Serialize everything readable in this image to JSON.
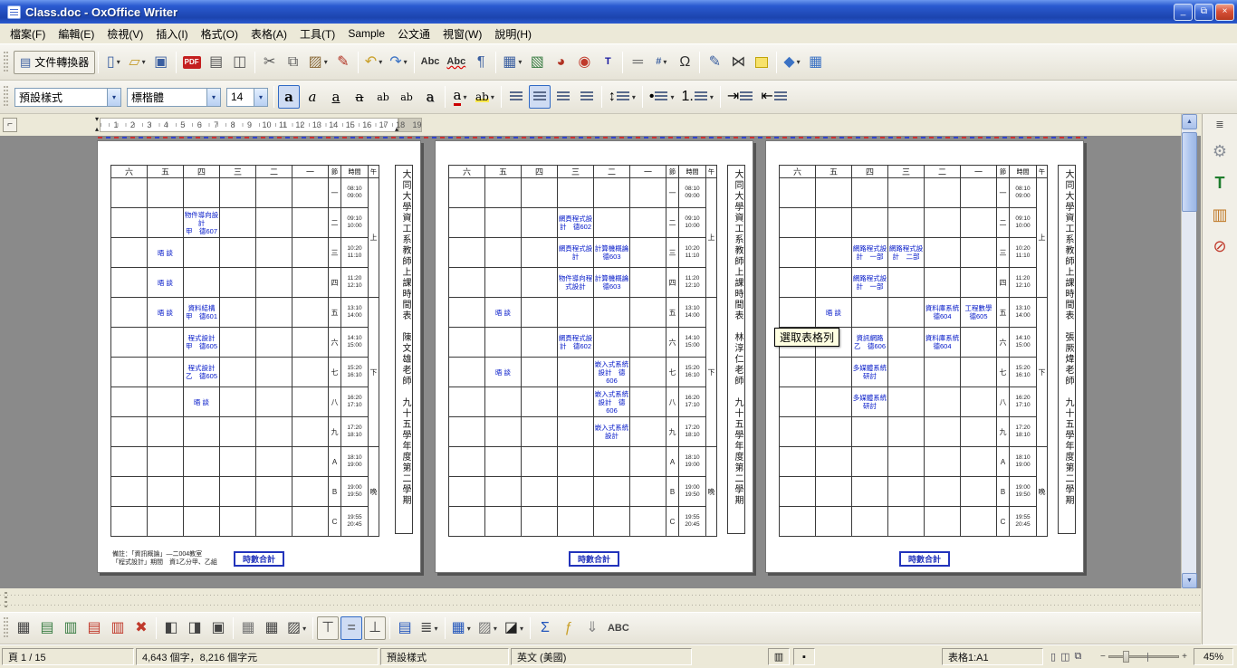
{
  "window": {
    "title": "Class.doc - OxOffice Writer",
    "controls": {
      "minimize": "_",
      "restore": "⧉",
      "close": "×"
    }
  },
  "menu": [
    "檔案(F)",
    "編輯(E)",
    "檢視(V)",
    "插入(I)",
    "格式(O)",
    "表格(A)",
    "工具(T)",
    "Sample",
    "公文通",
    "視窗(W)",
    "說明(H)"
  ],
  "toolbar_main": {
    "converter": "文件轉換器",
    "buttons": [
      {
        "n": "new-document-button",
        "g": "▯",
        "c": "#3b5fa0",
        "dd": true
      },
      {
        "n": "open-button",
        "g": "▱",
        "c": "#c49a2a",
        "dd": true
      },
      {
        "n": "save-button",
        "g": "▣",
        "c": "#3b5fa0"
      },
      {
        "sep": true
      },
      {
        "n": "export-pdf-button",
        "g": "PDF",
        "cls": "pdf"
      },
      {
        "n": "print-button",
        "g": "▤",
        "c": "#555"
      },
      {
        "n": "print-preview-button",
        "g": "◫",
        "c": "#555"
      },
      {
        "sep": true
      },
      {
        "n": "cut-button",
        "g": "✂",
        "c": "#555"
      },
      {
        "n": "copy-button",
        "g": "⧉",
        "c": "#555"
      },
      {
        "n": "paste-button",
        "g": "▨",
        "c": "#8a6a3a",
        "dd": true
      },
      {
        "n": "format-paintbrush-button",
        "g": "✎",
        "c": "#b03020"
      },
      {
        "sep": true
      },
      {
        "n": "undo-button",
        "g": "↶",
        "c": "#caa12c",
        "dd": true
      },
      {
        "n": "redo-button",
        "g": "↷",
        "c": "#3b72c4",
        "dd": true
      },
      {
        "sep": true
      },
      {
        "n": "spellcheck-button",
        "g": "Abc",
        "cls": "txt",
        "c": "#333"
      },
      {
        "n": "autospellcheck-button",
        "g": "Abc",
        "cls": "txt wavy",
        "c": "#333"
      },
      {
        "n": "formatting-marks-button",
        "g": "¶",
        "c": "#3b5fa0"
      },
      {
        "sep": true
      },
      {
        "n": "insert-table-button",
        "g": "▦",
        "c": "#3b5fa0",
        "dd": true
      },
      {
        "n": "insert-image-button",
        "g": "▧",
        "c": "#3a7d44"
      },
      {
        "n": "insert-chart-button",
        "g": "◕",
        "c": "#b03020"
      },
      {
        "n": "media-button",
        "g": "◉",
        "c": "#c0392b"
      },
      {
        "n": "text-box-button",
        "g": "T",
        "cls": "txt",
        "c": "#1a1aa0"
      },
      {
        "sep": true
      },
      {
        "n": "horizontal-line-button",
        "g": "═",
        "c": "#666"
      },
      {
        "n": "insert-fields-button",
        "g": "#",
        "cls": "txt",
        "c": "#3b5fa0",
        "dd": true
      },
      {
        "n": "special-character-button",
        "g": "Ω",
        "c": "#333"
      },
      {
        "sep": true
      },
      {
        "n": "edit-file-button",
        "g": "✎",
        "c": "#3b5fa0"
      },
      {
        "n": "mail-merge-button",
        "g": "⋈",
        "c": "#333"
      },
      {
        "n": "insert-note-button",
        "g": "",
        "cls": "noteicon"
      },
      {
        "sep": true
      },
      {
        "n": "gallery-button",
        "g": "◆",
        "c": "#3b72c4",
        "dd": true
      },
      {
        "n": "data-sources-button",
        "g": "▦",
        "c": "#3b72c4"
      }
    ]
  },
  "toolbar_format": {
    "style": "預設樣式",
    "font": "標楷體",
    "size": "14",
    "buttons": [
      {
        "n": "bold-button",
        "g": "a",
        "cls": "fa b",
        "active": true
      },
      {
        "n": "italic-button",
        "g": "a",
        "cls": "fa i"
      },
      {
        "n": "underline-button",
        "g": "a",
        "cls": "fa u"
      },
      {
        "n": "strikethrough-button",
        "g": "a",
        "cls": "fa s"
      },
      {
        "n": "superscript-button",
        "g": "ab",
        "cls": "fa sup"
      },
      {
        "n": "subscript-button",
        "g": "ab",
        "cls": "fa sub"
      },
      {
        "n": "shadow-button",
        "g": "a",
        "cls": "fa sh"
      },
      {
        "sep": true
      },
      {
        "n": "font-color-button",
        "g": "a",
        "cls": "fa fc",
        "dd": true
      },
      {
        "n": "highlight-button",
        "g": "ab",
        "cls": "fa hl",
        "dd": true
      },
      {
        "sep": true
      },
      {
        "n": "align-left-button",
        "bars": true
      },
      {
        "n": "align-center-button",
        "bars": true,
        "active": true
      },
      {
        "n": "align-right-button",
        "bars": true
      },
      {
        "n": "justify-button",
        "bars": true
      },
      {
        "sep": true
      },
      {
        "n": "line-spacing-button",
        "g": "↕",
        "bars": true,
        "dd": true
      },
      {
        "sep": true
      },
      {
        "n": "bullets-button",
        "g": "•",
        "bars": true,
        "dd": true
      },
      {
        "n": "numbering-button",
        "g": "1.",
        "bars": true,
        "dd": true
      },
      {
        "sep": true
      },
      {
        "n": "increase-indent-button",
        "g": "⇥",
        "bars": true
      },
      {
        "n": "decrease-indent-button",
        "g": "⇤",
        "bars": true
      }
    ]
  },
  "ruler": {
    "numbers": [
      1,
      2,
      3,
      4,
      5,
      6,
      7,
      8,
      9,
      10,
      11,
      12,
      13,
      14,
      15,
      16,
      17,
      18,
      19
    ]
  },
  "document": {
    "tooltip": "選取表格列",
    "days": [
      "六",
      "五",
      "四",
      "三",
      "二",
      "一"
    ],
    "header": {
      "period": "節",
      "time": "時間",
      "band": "午"
    },
    "bands": [
      {
        "label": "上",
        "span": 4
      },
      {
        "label": "下",
        "span": 5
      },
      {
        "label": "晚",
        "span": 3
      }
    ],
    "periods": [
      {
        "num": "一",
        "t1": "08:10",
        "t2": "09:00"
      },
      {
        "num": "二",
        "t1": "09:10",
        "t2": "10:00"
      },
      {
        "num": "三",
        "t1": "10:20",
        "t2": "11:10"
      },
      {
        "num": "四",
        "t1": "11:20",
        "t2": "12:10"
      },
      {
        "num": "五",
        "t1": "13:10",
        "t2": "14:00"
      },
      {
        "num": "六",
        "t1": "14:10",
        "t2": "15:00"
      },
      {
        "num": "七",
        "t1": "15:20",
        "t2": "16:10"
      },
      {
        "num": "八",
        "t1": "16:20",
        "t2": "17:10"
      },
      {
        "num": "九",
        "t1": "17:20",
        "t2": "18:10"
      },
      {
        "num": "A",
        "t1": "18:10",
        "t2": "19:00"
      },
      {
        "num": "B",
        "t1": "19:00",
        "t2": "19:50"
      },
      {
        "num": "C",
        "t1": "19:55",
        "t2": "20:45"
      }
    ],
    "pages": [
      {
        "title": "大同大學資工系教師上課時間表",
        "teacher": "陳文雄老師",
        "term": "九十五學年度第二學期",
        "stamp": "時數合計",
        "note": [
          "備註：「資訊概論」—二004教室",
          "「程式設計」期間　資1乙分甲、乙組"
        ],
        "entries": [
          {
            "r": 1,
            "d": 2,
            "lines": [
              "物件導向設計",
              "甲　德607"
            ]
          },
          {
            "r": 2,
            "d": 1,
            "lines": [
              "晤 談"
            ]
          },
          {
            "r": 3,
            "d": 1,
            "lines": [
              "晤 談"
            ]
          },
          {
            "r": 4,
            "d": 1,
            "lines": [
              "晤 談"
            ]
          },
          {
            "r": 4,
            "d": 2,
            "lines": [
              "資料結構",
              "甲　德601"
            ]
          },
          {
            "r": 5,
            "d": 2,
            "lines": [
              "程式設計",
              "甲　德605"
            ]
          },
          {
            "r": 6,
            "d": 2,
            "lines": [
              "程式設計",
              "乙　德605"
            ]
          },
          {
            "r": 7,
            "d": 2,
            "lines": [
              "晤 談"
            ]
          }
        ]
      },
      {
        "title": "大同大學資工系教師上課時間表",
        "teacher": "林淳仁老師",
        "term": "九十五學年度第二學期",
        "stamp": "時數合計",
        "note": null,
        "entries": [
          {
            "r": 1,
            "d": 3,
            "lines": [
              "網頁程式設",
              "計　德602"
            ]
          },
          {
            "r": 2,
            "d": 3,
            "lines": [
              "網頁程式設",
              "計"
            ]
          },
          {
            "r": 2,
            "d": 4,
            "lines": [
              "計算機概論",
              "德603"
            ]
          },
          {
            "r": 3,
            "d": 3,
            "lines": [
              "物件導向程",
              "式設計"
            ]
          },
          {
            "r": 3,
            "d": 4,
            "lines": [
              "計算機概論",
              "德603"
            ]
          },
          {
            "r": 4,
            "d": 1,
            "lines": [
              "晤 談"
            ]
          },
          {
            "r": 5,
            "d": 3,
            "lines": [
              "網頁程式設",
              "計　德602"
            ]
          },
          {
            "r": 6,
            "d": 1,
            "lines": [
              "晤 談"
            ]
          },
          {
            "r": 6,
            "d": 4,
            "lines": [
              "嵌入式系統",
              "設計　德606"
            ]
          },
          {
            "r": 7,
            "d": 4,
            "lines": [
              "嵌入式系統",
              "設計　德606"
            ]
          },
          {
            "r": 8,
            "d": 4,
            "lines": [
              "嵌入式系統",
              "設計"
            ]
          }
        ]
      },
      {
        "title": "大同大學資工系教師上課時間表",
        "teacher": "張厥煒老師",
        "term": "九十五學年度第二學期",
        "stamp": "時數合計",
        "note": null,
        "entries": [
          {
            "r": 2,
            "d": 2,
            "lines": [
              "網路程式設",
              "計　一部"
            ]
          },
          {
            "r": 2,
            "d": 3,
            "lines": [
              "網路程式設",
              "計　二部"
            ]
          },
          {
            "r": 3,
            "d": 2,
            "lines": [
              "網路程式設",
              "計　一部"
            ]
          },
          {
            "r": 4,
            "d": 1,
            "lines": [
              "晤 談"
            ]
          },
          {
            "r": 4,
            "d": 4,
            "lines": [
              "資料庫系統",
              "德604"
            ]
          },
          {
            "r": 4,
            "d": 5,
            "lines": [
              "工程數學",
              "德605"
            ]
          },
          {
            "r": 5,
            "d": 2,
            "lines": [
              "資訊網路",
              "乙　德606"
            ]
          },
          {
            "r": 5,
            "d": 4,
            "lines": [
              "資料庫系統",
              "德604"
            ]
          },
          {
            "r": 6,
            "d": 2,
            "lines": [
              "多媒體系統",
              "研討"
            ]
          },
          {
            "r": 7,
            "d": 2,
            "lines": [
              "多媒體系統",
              "研討"
            ]
          }
        ]
      }
    ]
  },
  "table_toolbar": {
    "buttons": [
      {
        "n": "table-select-button",
        "g": "▦",
        "c": "#444"
      },
      {
        "n": "insert-row-button",
        "g": "▤",
        "c": "#3a7d44"
      },
      {
        "n": "insert-column-button",
        "g": "▥",
        "c": "#3a7d44"
      },
      {
        "n": "delete-row-button",
        "g": "▤",
        "c": "#c0392b"
      },
      {
        "n": "delete-column-button",
        "g": "▥",
        "c": "#c0392b"
      },
      {
        "n": "delete-table-button",
        "g": "✖",
        "c": "#c0392b"
      },
      {
        "sep": true
      },
      {
        "n": "split-cells-horizontal-button",
        "g": "◧",
        "c": "#444"
      },
      {
        "n": "split-cells-vertical-button",
        "g": "◨",
        "c": "#444"
      },
      {
        "n": "merge-cells-button",
        "g": "▣",
        "c": "#444"
      },
      {
        "sep": true
      },
      {
        "n": "autoformat-button",
        "g": "▦",
        "c": "#777"
      },
      {
        "n": "table-properties-button",
        "g": "▦",
        "c": "#444"
      },
      {
        "n": "borders-button",
        "g": "▨",
        "c": "#444",
        "dd": true
      },
      {
        "sep": true
      },
      {
        "n": "top-align-button",
        "g": "⊤",
        "c": "#444",
        "boxed": true
      },
      {
        "n": "center-vertical-button",
        "g": "=",
        "c": "#444",
        "boxed": true,
        "active": true
      },
      {
        "n": "bottom-align-button",
        "g": "⊥",
        "c": "#444",
        "boxed": true
      },
      {
        "sep": true
      },
      {
        "n": "insert-frame-button",
        "g": "▤",
        "c": "#2255bb"
      },
      {
        "n": "line-style-button",
        "g": "≣",
        "c": "#444",
        "dd": true
      },
      {
        "sep": true
      },
      {
        "n": "background-color-button",
        "g": "▦",
        "c": "#2255bb",
        "dd": true
      },
      {
        "n": "border-style-button",
        "g": "▨",
        "c": "#777",
        "dd": true
      },
      {
        "n": "border-color-button",
        "g": "◪",
        "c": "#222",
        "dd": true
      },
      {
        "sep": true
      },
      {
        "n": "sum-button",
        "g": "Σ",
        "c": "#2255bb"
      },
      {
        "n": "formula-button",
        "g": "ƒ",
        "c": "#caa12c"
      },
      {
        "n": "sort-button",
        "g": "⇓",
        "c": "#888"
      },
      {
        "n": "data-to-text-button",
        "g": "ABC",
        "cls": "txt",
        "c": "#444"
      }
    ]
  },
  "sidebar": {
    "icons": [
      {
        "n": "sidebar-menu-button",
        "g": "≣",
        "c": "#444",
        "small": true
      },
      {
        "n": "tools-customize-button",
        "g": "⚙",
        "c": "#8a8f98"
      },
      {
        "n": "text-attributes-button",
        "g": "T",
        "cls": "txt",
        "c": "#1f7d2d"
      },
      {
        "n": "package-button",
        "g": "▥",
        "c": "#c07a28"
      },
      {
        "n": "no-function-button",
        "g": "⊘",
        "c": "#c0392b"
      }
    ]
  },
  "statusbar": {
    "page": "頁 1 / 15",
    "words": "4,643 個字，8,216 個字元",
    "style": "預設樣式",
    "language": "英文 (美國)",
    "cell": "表格1:A1",
    "zoom": "45%",
    "mode1": "▥",
    "mode2": "▪",
    "view_icons": [
      "▯",
      "◫",
      "⧉"
    ]
  }
}
